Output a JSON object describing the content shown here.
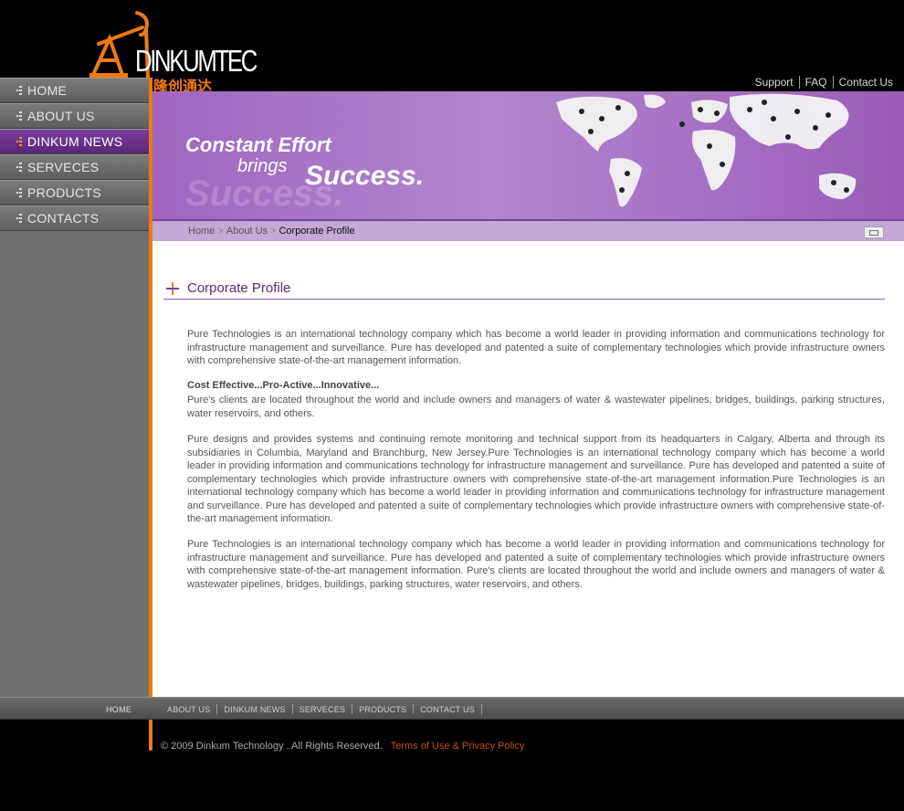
{
  "logo": {
    "brand": "DINKUMTEC",
    "brand_chinese": "隆创通达"
  },
  "top_links": [
    "Support",
    "FAQ",
    "Contact Us"
  ],
  "sidebar": {
    "items": [
      {
        "label": "HOME",
        "active": false
      },
      {
        "label": "ABOUT US",
        "active": false
      },
      {
        "label": "DINKUM NEWS",
        "active": true
      },
      {
        "label": "SERVECES",
        "active": false
      },
      {
        "label": "PRODUCTS",
        "active": false
      },
      {
        "label": "CONTACTS",
        "active": false
      }
    ]
  },
  "banner": {
    "line1": "Constant Effort",
    "line2": "brings",
    "line3": "Success.",
    "ghost": "Success."
  },
  "breadcrumb": {
    "items": [
      "Home",
      "About Us"
    ],
    "current": "Corporate Profile"
  },
  "content": {
    "section_title": "Corporate Profile",
    "paragraph1": "Pure Technologies is an international technology company which has become a world leader in providing information and communications technology for infrastructure management and surveillance. Pure has developed and patented a suite of complementary technologies which provide infrastructure owners with comprehensive state-of-the-art management information.",
    "subheading": "Cost Effective...Pro-Active...Innovative...",
    "paragraph2": "Pure's clients are located throughout the world and include owners and managers of water & wastewater pipelines, bridges, buildings, parking structures, water reservoirs, and others.",
    "paragraph3": "Pure designs and provides systems and continuing remote monitoring and technical support from its headquarters in Calgary, Alberta and through its subsidiaries in Columbia, Maryland and Branchburg, New Jersey.Pure Technologies is an international technology company which has become a world leader in providing information and communications technology for infrastructure management and surveillance. Pure has developed and patented a suite of complementary technologies which provide infrastructure owners with comprehensive state-of-the-art management information.Pure Technologies is an international technology company which has become a world leader in providing information and communications technology for infrastructure management and surveillance. Pure has developed and patented a suite of complementary technologies which provide infrastructure owners with comprehensive state-of-the-art management information.",
    "paragraph4": "Pure Technologies is an international technology company which has become a world leader in providing information and communications technology for infrastructure management and surveillance. Pure has developed and patented a suite of complementary technologies which provide infrastructure owners with comprehensive state-of-the-art management information. Pure's clients are located throughout the world and include owners and managers of water & wastewater pipelines, bridges, buildings, parking structures, water reservoirs, and others."
  },
  "footer_nav": {
    "home": "HOME",
    "links": [
      "ABOUT US",
      "DINKUM NEWS",
      "SERVECES",
      "PRODUCTS",
      "CONTACT US"
    ]
  },
  "footer": {
    "copyright": "© 2009 Dinkum Technology . All Rights Reserved.",
    "terms": "Terms of Use & Privacy Policy"
  },
  "colors": {
    "accent_orange": "#f07a10",
    "accent_purple": "#7b3d9b"
  },
  "icons": {
    "logo_icon": "oil-pumpjack-icon",
    "print_icon": "print-icon",
    "section_icon": "cross-icon",
    "nav_bullet": "bullet-icon"
  }
}
